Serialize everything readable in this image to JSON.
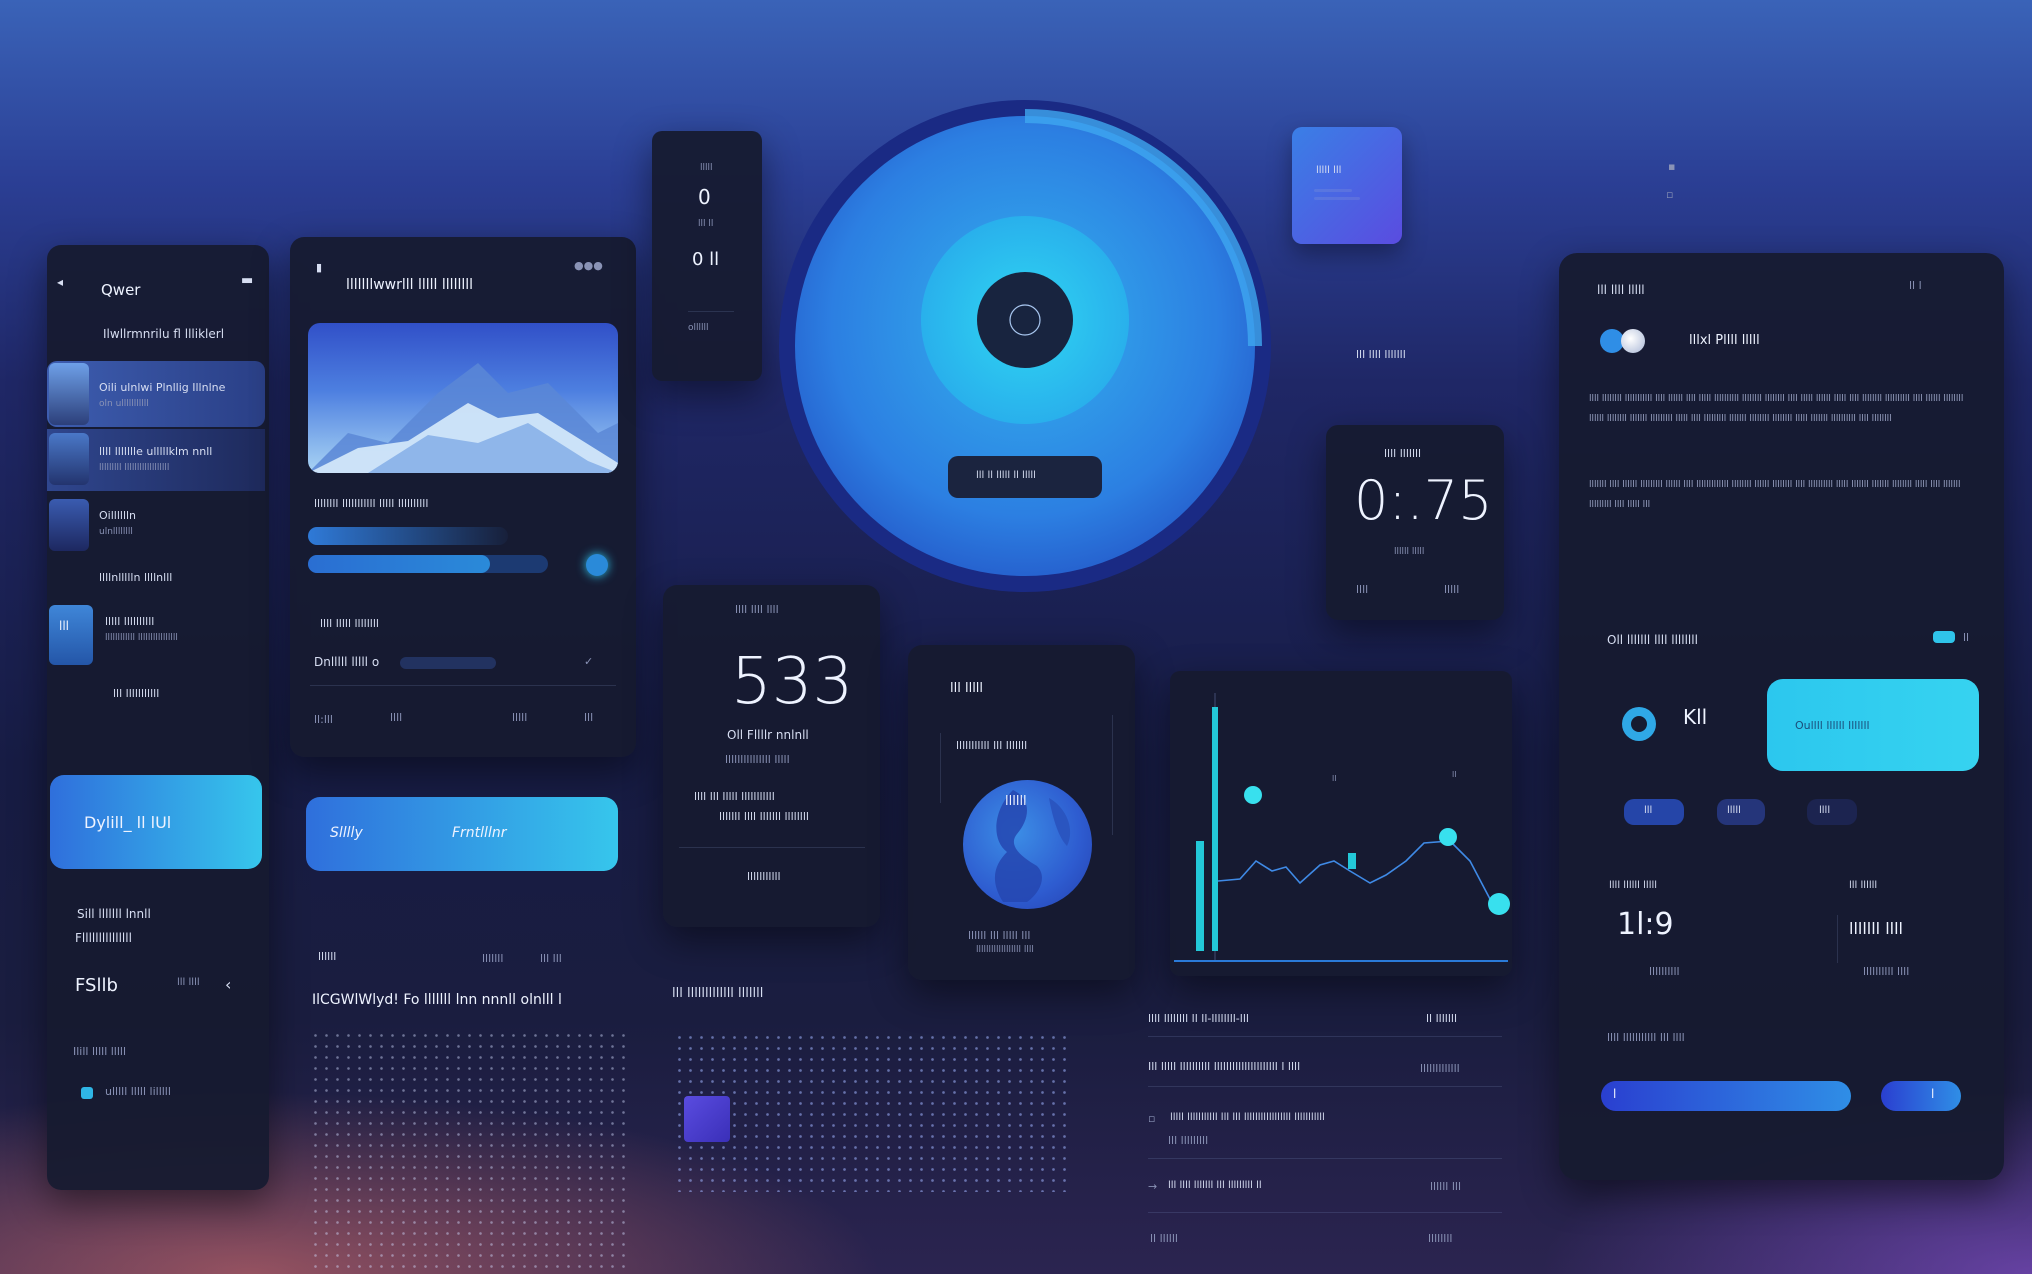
{
  "left_panel": {
    "title": "Qwer",
    "subtitle": "Ilwllrmnrilu fl llliklerl",
    "items": [
      {
        "label": "Oili ulnlwi Plnllig Illnlne",
        "sub": "oln ulllllllllll"
      },
      {
        "label": "llll llllllle ulllllklm nnll",
        "sub": "lllllllll llllllllllllllllll"
      },
      {
        "label": "Oilllllln",
        "sub": "ulnllllllll"
      },
      {
        "label": "llllnllllln llllnlll",
        "sub": ""
      },
      {
        "label": "lllll llllllllll",
        "sub": "llllllllllll llllllllllllllll"
      },
      {
        "label": "lll lllllllllll",
        "sub": ""
      }
    ],
    "thumb_badge": "lll",
    "cta_label": "Dylill_ ll lUl",
    "section_title_1": "Sill lllllll lnnll",
    "section_title_2": "Flllllllllllllll",
    "stat_left": "FSllb",
    "stat_mid": "lll llll",
    "footer_label": "Ilill lllll lllll",
    "footer_item": "ulllll lllll lilllll"
  },
  "media_panel": {
    "title": "lllllllwwrlll lllll llllllll",
    "image_caption": "llllllll lllllllllll lllll llllllllll",
    "progress_value": 0.76,
    "progress_label_1": "llll lllll llllllll",
    "progress_label_2": "Dnlllll lllll o",
    "time_left": "ll:lll",
    "time_mid": "llll",
    "time_right": "lllll",
    "time_end": "lll",
    "cta_left": "Slllly",
    "cta_right": "Frntlllnr"
  },
  "mini_card": {
    "top_label": "lllll",
    "value_1": "0",
    "label_1": "lll ll",
    "value_2": "0 ll",
    "label_2": "ollllll"
  },
  "dial": {
    "button_label": "lll ll lllll ll lllll"
  },
  "tile": {
    "label": "lllll lll"
  },
  "side_caption": "lll llll lllllll",
  "timer": {
    "label": "llll lllllll",
    "value": "0:.75",
    "sub": "llllll lllll",
    "left": "llll",
    "right": "lllll"
  },
  "stat_card": {
    "top_label": "llll llll llll",
    "value": "533",
    "label": "Oll Fllllr nnlnll",
    "sub": "lllllllllllllll lllll",
    "line_1": "llll lll lllll lllllllllll",
    "line_2": "lllllll llll lllllll llllllll",
    "footer": "lllllllllll"
  },
  "globe_card": {
    "title": "lll lllll",
    "subtitle": "lllllllllll lll lllllll",
    "globe_text": "llllll",
    "caption": "llllll lll lllll lll",
    "caption_2": "llllllllllllllllll llll"
  },
  "line_chart": {
    "markers": [
      0.42,
      0.33,
      0.2
    ]
  },
  "list_panel": {
    "rows": [
      {
        "left": "llll llllllll ll ll-llllllll-lll",
        "right": "ll lllllll"
      },
      {
        "left": "Ill lllll llllllllll lllllllllllllllllllll l llll",
        "right": "lllllllllllll"
      },
      {
        "left": "lllll lllllllllll lll lll lllllllllllllllll lllllllllll",
        "right": "lll lllllllll"
      },
      {
        "left": "lll llll lllllll lll lllllllll ll",
        "right": "llllll lll"
      },
      {
        "left": "ll llllll",
        "right": "llllllll"
      }
    ]
  },
  "text_block_1": {
    "title": "lll lllllllllllll lllllll",
    "left_title": "llllll",
    "date": "lllllll",
    "extra": "lll lll",
    "headline": "IlCGWlWlyd! Fo lllllll lnn nnnll olnlll l"
  },
  "right_panel": {
    "header": "lll llll lllll",
    "header_right": "ll l",
    "user_name": "lllxl Pllll lllll",
    "paragraph_1": "llll llllllll lllllllllll llll llllll llll lllll llllllllll llllllll llllllll llll lllll llllll lllll llll llllllll llllllllll llll llllll llllllll llllll llllllll lllllll lllllllll lllll llll lllllllll lllllll llllllll llllllll lllll lllllll llllllllll llll llllllll",
    "paragraph_2": "lllllll llll llllll lllllllll llllll llll lllllllllllll llllllll llllll llllllll llll llllllllll lllll lllllll lllllll llllllll lllll llll lllllll lllllllll llll lllll lll",
    "section_title": "Oll lllllll llll llllllll",
    "section_badge": "ll",
    "score_value": "Kll",
    "cta_label": "Oullll llllll lllllll",
    "chips": [
      "lll",
      "lllll",
      "llll"
    ],
    "stat_1_label": "llll llllll lllll",
    "stat_1_value": "1l:9",
    "stat_1_sub": "llllllllll",
    "stat_2_label": "lll llllll",
    "stat_2_value": "lllllll llll",
    "stat_2_sub": "llllllllll llll",
    "footer_label": "llll lllllllllll lll llll",
    "bottom_btn_1": "l",
    "bottom_btn_2": "l"
  },
  "colors": {
    "accent": "#2fc4ea",
    "accent_blue": "#2f6fdc",
    "panel": "#161b30"
  }
}
